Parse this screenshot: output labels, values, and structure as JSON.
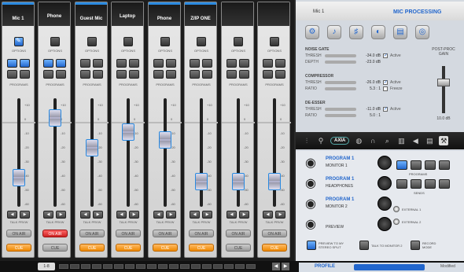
{
  "strips": [
    {
      "name": "Mic 1",
      "selected": true,
      "options_on": true,
      "programs_on": [
        true,
        true,
        false,
        false
      ],
      "fader_pos": 0.78,
      "talk": [
        "TALK",
        "PRVW"
      ],
      "on_air": "ON AIR",
      "cue": "CUE",
      "on_air_red": false
    },
    {
      "name": "Phone",
      "selected": false,
      "options_on": false,
      "programs_on": [
        true,
        true,
        false,
        false
      ],
      "fader_pos": 0.12,
      "talk": [
        "TALK",
        "PRVW"
      ],
      "on_air": "ON AIR",
      "cue": "CUE",
      "on_air_red": true
    },
    {
      "name": "Guest Mic",
      "selected": true,
      "options_on": false,
      "programs_on": [
        false,
        false,
        false,
        false
      ],
      "fader_pos": 0.45,
      "talk": [
        "TALK",
        "PRVW"
      ],
      "on_air": "ON AIR",
      "cue": "CUE",
      "on_air_red": false
    },
    {
      "name": "Laptop",
      "selected": false,
      "options_on": false,
      "programs_on": [
        false,
        false,
        false,
        false
      ],
      "fader_pos": 0.28,
      "talk": [
        "TALK",
        "PRVW"
      ],
      "on_air": "ON AIR",
      "cue": "CUE",
      "on_air_red": false
    },
    {
      "name": "Phone",
      "selected": true,
      "options_on": false,
      "programs_on": [
        false,
        false,
        false,
        false
      ],
      "fader_pos": 0.36,
      "talk": [
        "TALK",
        "PRVW"
      ],
      "on_air": "ON AIR",
      "cue": "CUE",
      "on_air_red": false
    },
    {
      "name": "Z/IP ONE",
      "selected": true,
      "options_on": false,
      "programs_on": [
        false,
        false,
        false,
        false
      ],
      "fader_pos": 0.82,
      "talk": [
        "TALK",
        "PRVW"
      ],
      "on_air": "ON AIR",
      "cue": "CUE",
      "on_air_red": false
    },
    {
      "name": "",
      "selected": false,
      "options_on": false,
      "programs_on": [
        false,
        false,
        false,
        false
      ],
      "fader_pos": 0.82,
      "talk": [
        "TALK",
        "PRVW"
      ],
      "on_air": "ON AIR",
      "cue": "CUE",
      "on_air_red": false
    },
    {
      "name": "",
      "selected": false,
      "options_on": false,
      "programs_on": [
        false,
        false,
        false,
        false
      ],
      "fader_pos": 0.82,
      "talk": [
        "TALK",
        "PRVW"
      ],
      "on_air": "ON AIR",
      "cue": "CUE",
      "on_air_red": false
    }
  ],
  "strip_labels": {
    "options": "OPTIONS",
    "programs": "PROGRAMS"
  },
  "fader_scale": [
    "+10",
    "0",
    "-10",
    "-20",
    "-30",
    "-40",
    "-50",
    "-60"
  ],
  "bottom": {
    "position": "1-8"
  },
  "mic_processing": {
    "channel": "Mic 1",
    "title": "MIC PROCESSING",
    "noise_gate": {
      "title": "NOISE GATE",
      "thresh_label": "THRESH",
      "thresh_val": "-34.0 dB",
      "depth_label": "DEPTH",
      "depth_val": "-23.0 dB",
      "active": "Active"
    },
    "compressor": {
      "title": "COMPRESSOR",
      "thresh_label": "THRESH",
      "thresh_val": "-26.0 dB",
      "ratio_label": "RATIO",
      "ratio_val": "5.3 : 1",
      "active": "Active",
      "freeze": "Freeze"
    },
    "de_esser": {
      "title": "DE-ESSER",
      "thresh_label": "THRESH",
      "thresh_val": "-11.0 dB",
      "ratio_label": "RATIO",
      "ratio_val": "5.0 : 1",
      "active": "Active"
    },
    "post_proc": {
      "title": "POST-PROC GAIN",
      "value": "10.0 dB"
    }
  },
  "nav": {
    "logo": "AXIA"
  },
  "outputs": [
    {
      "title": "PROGRAM 1",
      "sub": "MONITOR 1"
    },
    {
      "title": "PROGRAM 1",
      "sub": "HEADPHONES"
    },
    {
      "title": "PROGRAM 1",
      "sub": "MONITOR 2"
    },
    {
      "title": "",
      "sub": "PREVIEW"
    }
  ],
  "routing": {
    "programs_label": "PROGRAMS",
    "sends_label": "SENDS",
    "external1": "EXTERNAL 1",
    "external2": "EXTERNAL 2"
  },
  "footer": {
    "preview_split": "PREVIEW TO MY STEREO SPLIT",
    "talk_to_monitors": "TALK TO MONITOR 2",
    "record_mode": "RECORD MODE"
  },
  "profile": {
    "label": "PROFILE",
    "modified": "Modified"
  }
}
